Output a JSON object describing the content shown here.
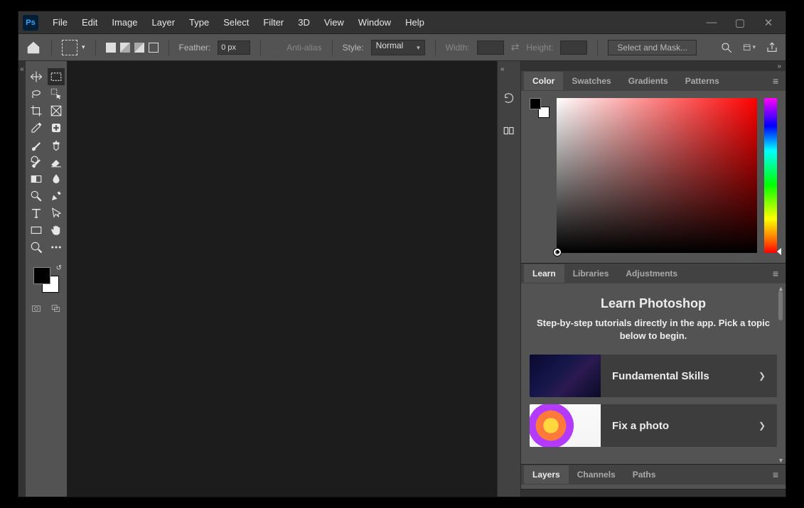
{
  "app": {
    "logo_text": "Ps"
  },
  "menus": [
    "File",
    "Edit",
    "Image",
    "Layer",
    "Type",
    "Select",
    "Filter",
    "3D",
    "View",
    "Window",
    "Help"
  ],
  "optbar": {
    "feather_label": "Feather:",
    "feather_value": "0 px",
    "antialias_label": "Anti-alias",
    "style_label": "Style:",
    "style_value": "Normal",
    "width_label": "Width:",
    "width_value": "",
    "height_label": "Height:",
    "height_value": "",
    "mask_button": "Select and Mask..."
  },
  "tools": [
    [
      "move",
      "marquee-rect"
    ],
    [
      "lasso",
      "quick-select"
    ],
    [
      "crop",
      "frame"
    ],
    [
      "eyedropper",
      "healing"
    ],
    [
      "brush",
      "clone"
    ],
    [
      "history-brush",
      "eraser"
    ],
    [
      "gradient",
      "blur"
    ],
    [
      "dodge",
      "pen"
    ],
    [
      "type",
      "path-select"
    ],
    [
      "rectangle",
      "hand"
    ],
    [
      "zoom",
      "more"
    ]
  ],
  "tool_selected": "marquee-rect",
  "colors": {
    "foreground": "#000000",
    "background": "#ffffff"
  },
  "mid_icons": [
    "history-icon",
    "properties-icon"
  ],
  "panel_color": {
    "tabs": [
      "Color",
      "Swatches",
      "Gradients",
      "Patterns"
    ],
    "active_tab": "Color"
  },
  "panel_learn": {
    "tabs": [
      "Learn",
      "Libraries",
      "Adjustments"
    ],
    "active_tab": "Learn",
    "title": "Learn Photoshop",
    "subtitle": "Step-by-step tutorials directly in the app. Pick a topic below to begin.",
    "cards": [
      {
        "label": "Fundamental Skills"
      },
      {
        "label": "Fix a photo"
      }
    ]
  },
  "panel_layers": {
    "tabs": [
      "Layers",
      "Channels",
      "Paths"
    ],
    "active_tab": "Layers"
  }
}
